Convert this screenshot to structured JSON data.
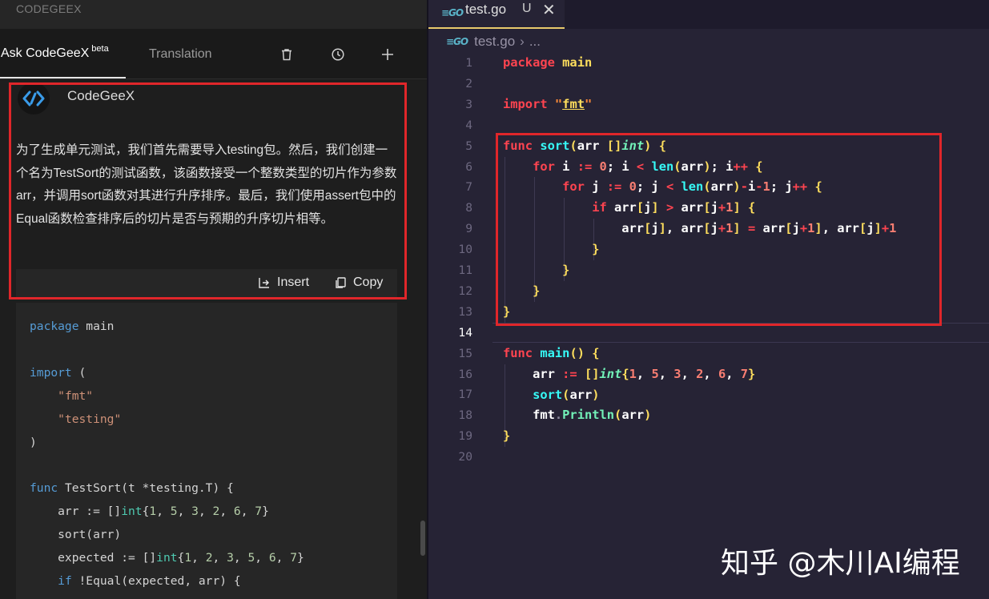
{
  "app": {
    "title": "CODEGEEX"
  },
  "tabs": {
    "ask": "Ask CodeGeeX",
    "beta": "beta",
    "translation": "Translation"
  },
  "header_icons": [
    "trash-icon",
    "history-icon",
    "plus-icon"
  ],
  "reply": {
    "bot_name": "CodeGeeX",
    "text": "为了生成单元测试，我们首先需要导入testing包。然后，我们创建一个名为TestSort的测试函数，该函数接受一个整数类型的切片作为参数arr，并调用sort函数对其进行升序排序。最后，我们使用assert包中的Equal函数检查排序后的切片是否与预期的升序切片相等。",
    "insert_label": "Insert",
    "copy_label": "Copy"
  },
  "left_code": [
    "package main",
    "",
    "import (",
    "    \"fmt\"",
    "    \"testing\"",
    ")",
    "",
    "func TestSort(t *testing.T) {",
    "    arr := []int{1, 5, 3, 2, 6, 7}",
    "    sort(arr)",
    "    expected := []int{1, 2, 3, 5, 6, 7}",
    "    if !Equal(expected, arr) {"
  ],
  "editor": {
    "tab_name": "test.go",
    "tab_status": "U",
    "breadcrumb_file": "test.go",
    "breadcrumb_more": "...",
    "active_line": 14,
    "line_numbers": [
      "1",
      "2",
      "3",
      "4",
      "5",
      "6",
      "7",
      "8",
      "9",
      "10",
      "11",
      "12",
      "13",
      "14",
      "15",
      "16",
      "17",
      "18",
      "19",
      "20"
    ],
    "code": [
      "package main",
      "",
      "import \"fmt\"",
      "",
      "func sort(arr []int) {",
      "    for i := 0; i < len(arr); i++ {",
      "        for j := 0; j < len(arr)-i-1; j++ {",
      "            if arr[j] > arr[j+1] {",
      "                arr[j], arr[j+1] = arr[j+1], arr[j]+1",
      "            }",
      "        }",
      "    }",
      "}",
      "",
      "func main() {",
      "    arr := []int{1, 5, 3, 2, 6, 7}",
      "    sort(arr)",
      "    fmt.Println(arr)",
      "}",
      ""
    ]
  },
  "watermark": "知乎 @木川AI编程",
  "colors": {
    "highlight_box": "#e0262a",
    "editor_bg": "#262335",
    "panel_bg": "#1e1e1e"
  }
}
